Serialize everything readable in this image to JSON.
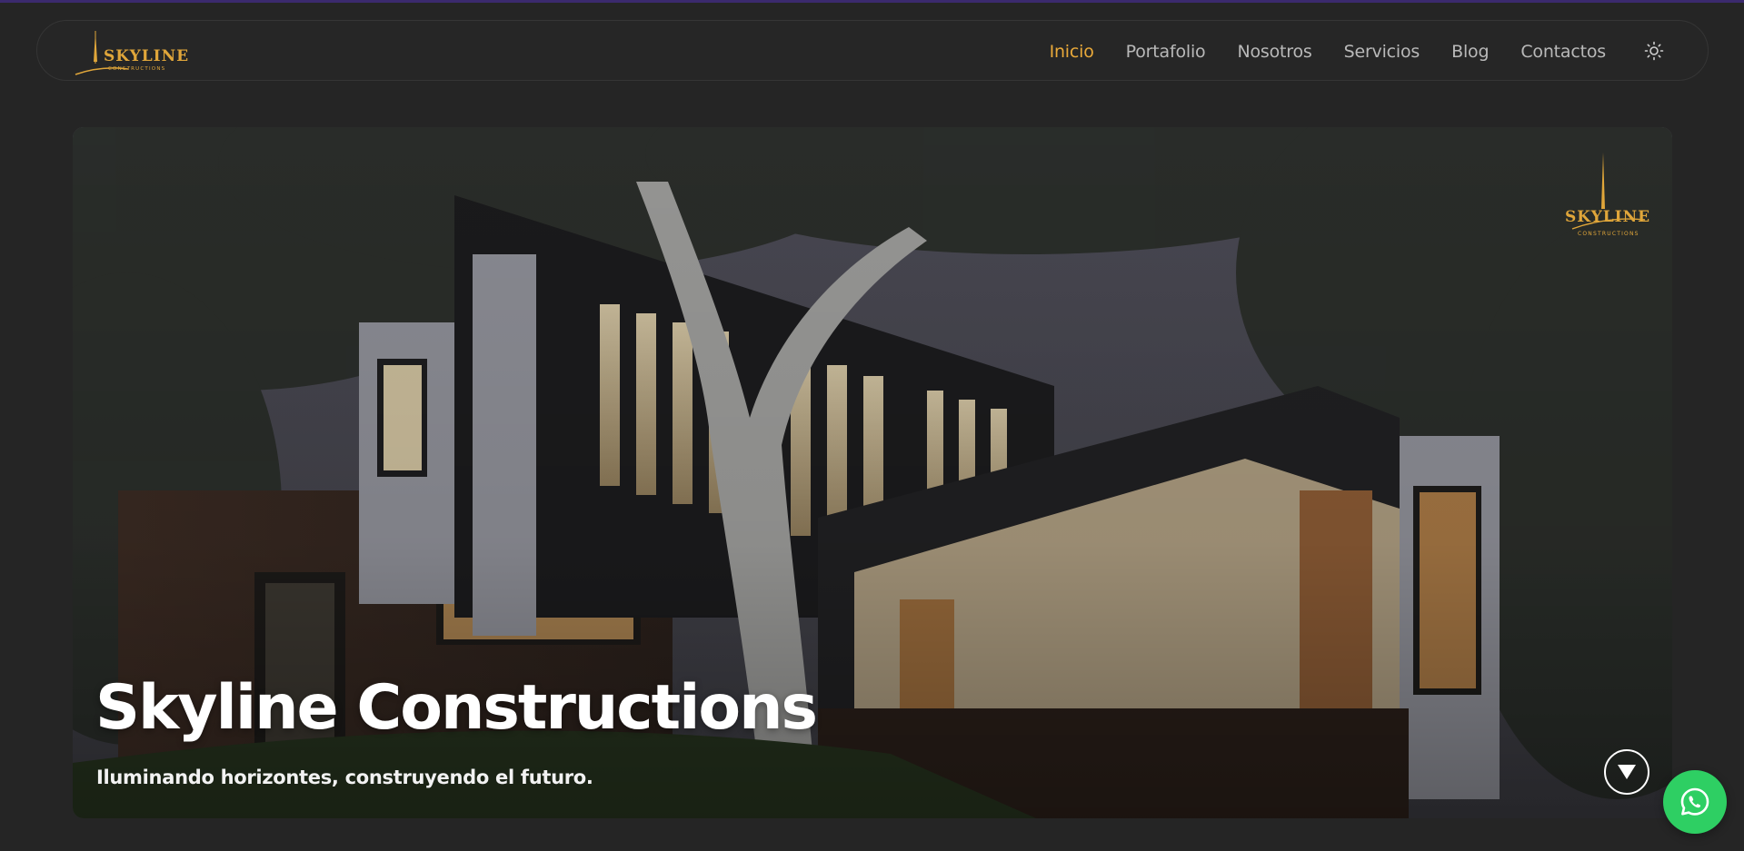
{
  "brand": {
    "name": "Skyline",
    "tagline": "Constructions",
    "logo_color": "#e0a63a"
  },
  "nav": {
    "items": [
      {
        "label": "Inicio",
        "active": true
      },
      {
        "label": "Portafolio",
        "active": false
      },
      {
        "label": "Nosotros",
        "active": false
      },
      {
        "label": "Servicios",
        "active": false
      },
      {
        "label": "Blog",
        "active": false
      },
      {
        "label": "Contactos",
        "active": false
      }
    ],
    "active_color": "#e9a93a",
    "theme_toggle_icon": "sun-icon"
  },
  "hero": {
    "title": "Skyline Constructions",
    "subtitle": "Iluminando horizontes, construyendo el futuro.",
    "scroll_icon": "triangle-down-icon"
  },
  "whatsapp": {
    "icon": "whatsapp-icon",
    "color": "#2ecf63"
  }
}
